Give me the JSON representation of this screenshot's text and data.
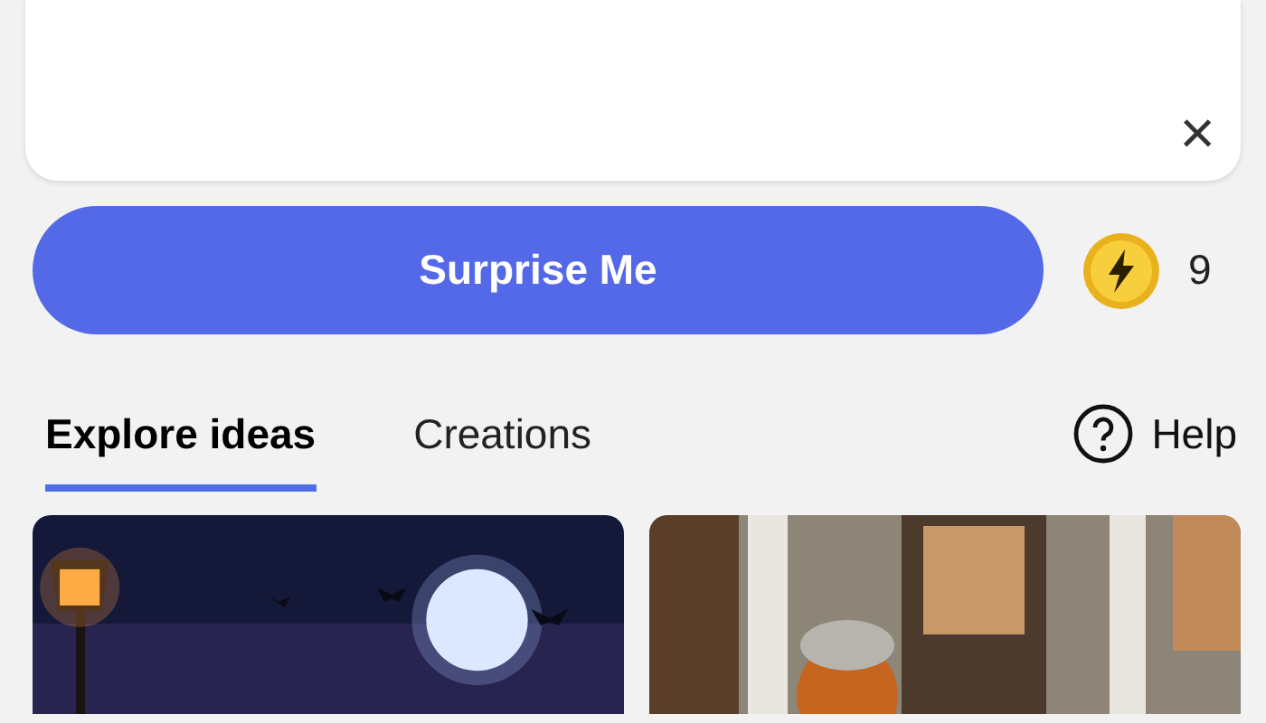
{
  "prompt_card": {
    "close": "×"
  },
  "surprise_button": {
    "label": "Surprise Me"
  },
  "boosts": {
    "count": "9"
  },
  "tabs": [
    {
      "label": "Explore ideas",
      "selected": true
    },
    {
      "label": "Creations",
      "selected": false
    }
  ],
  "help": {
    "label": "Help"
  }
}
